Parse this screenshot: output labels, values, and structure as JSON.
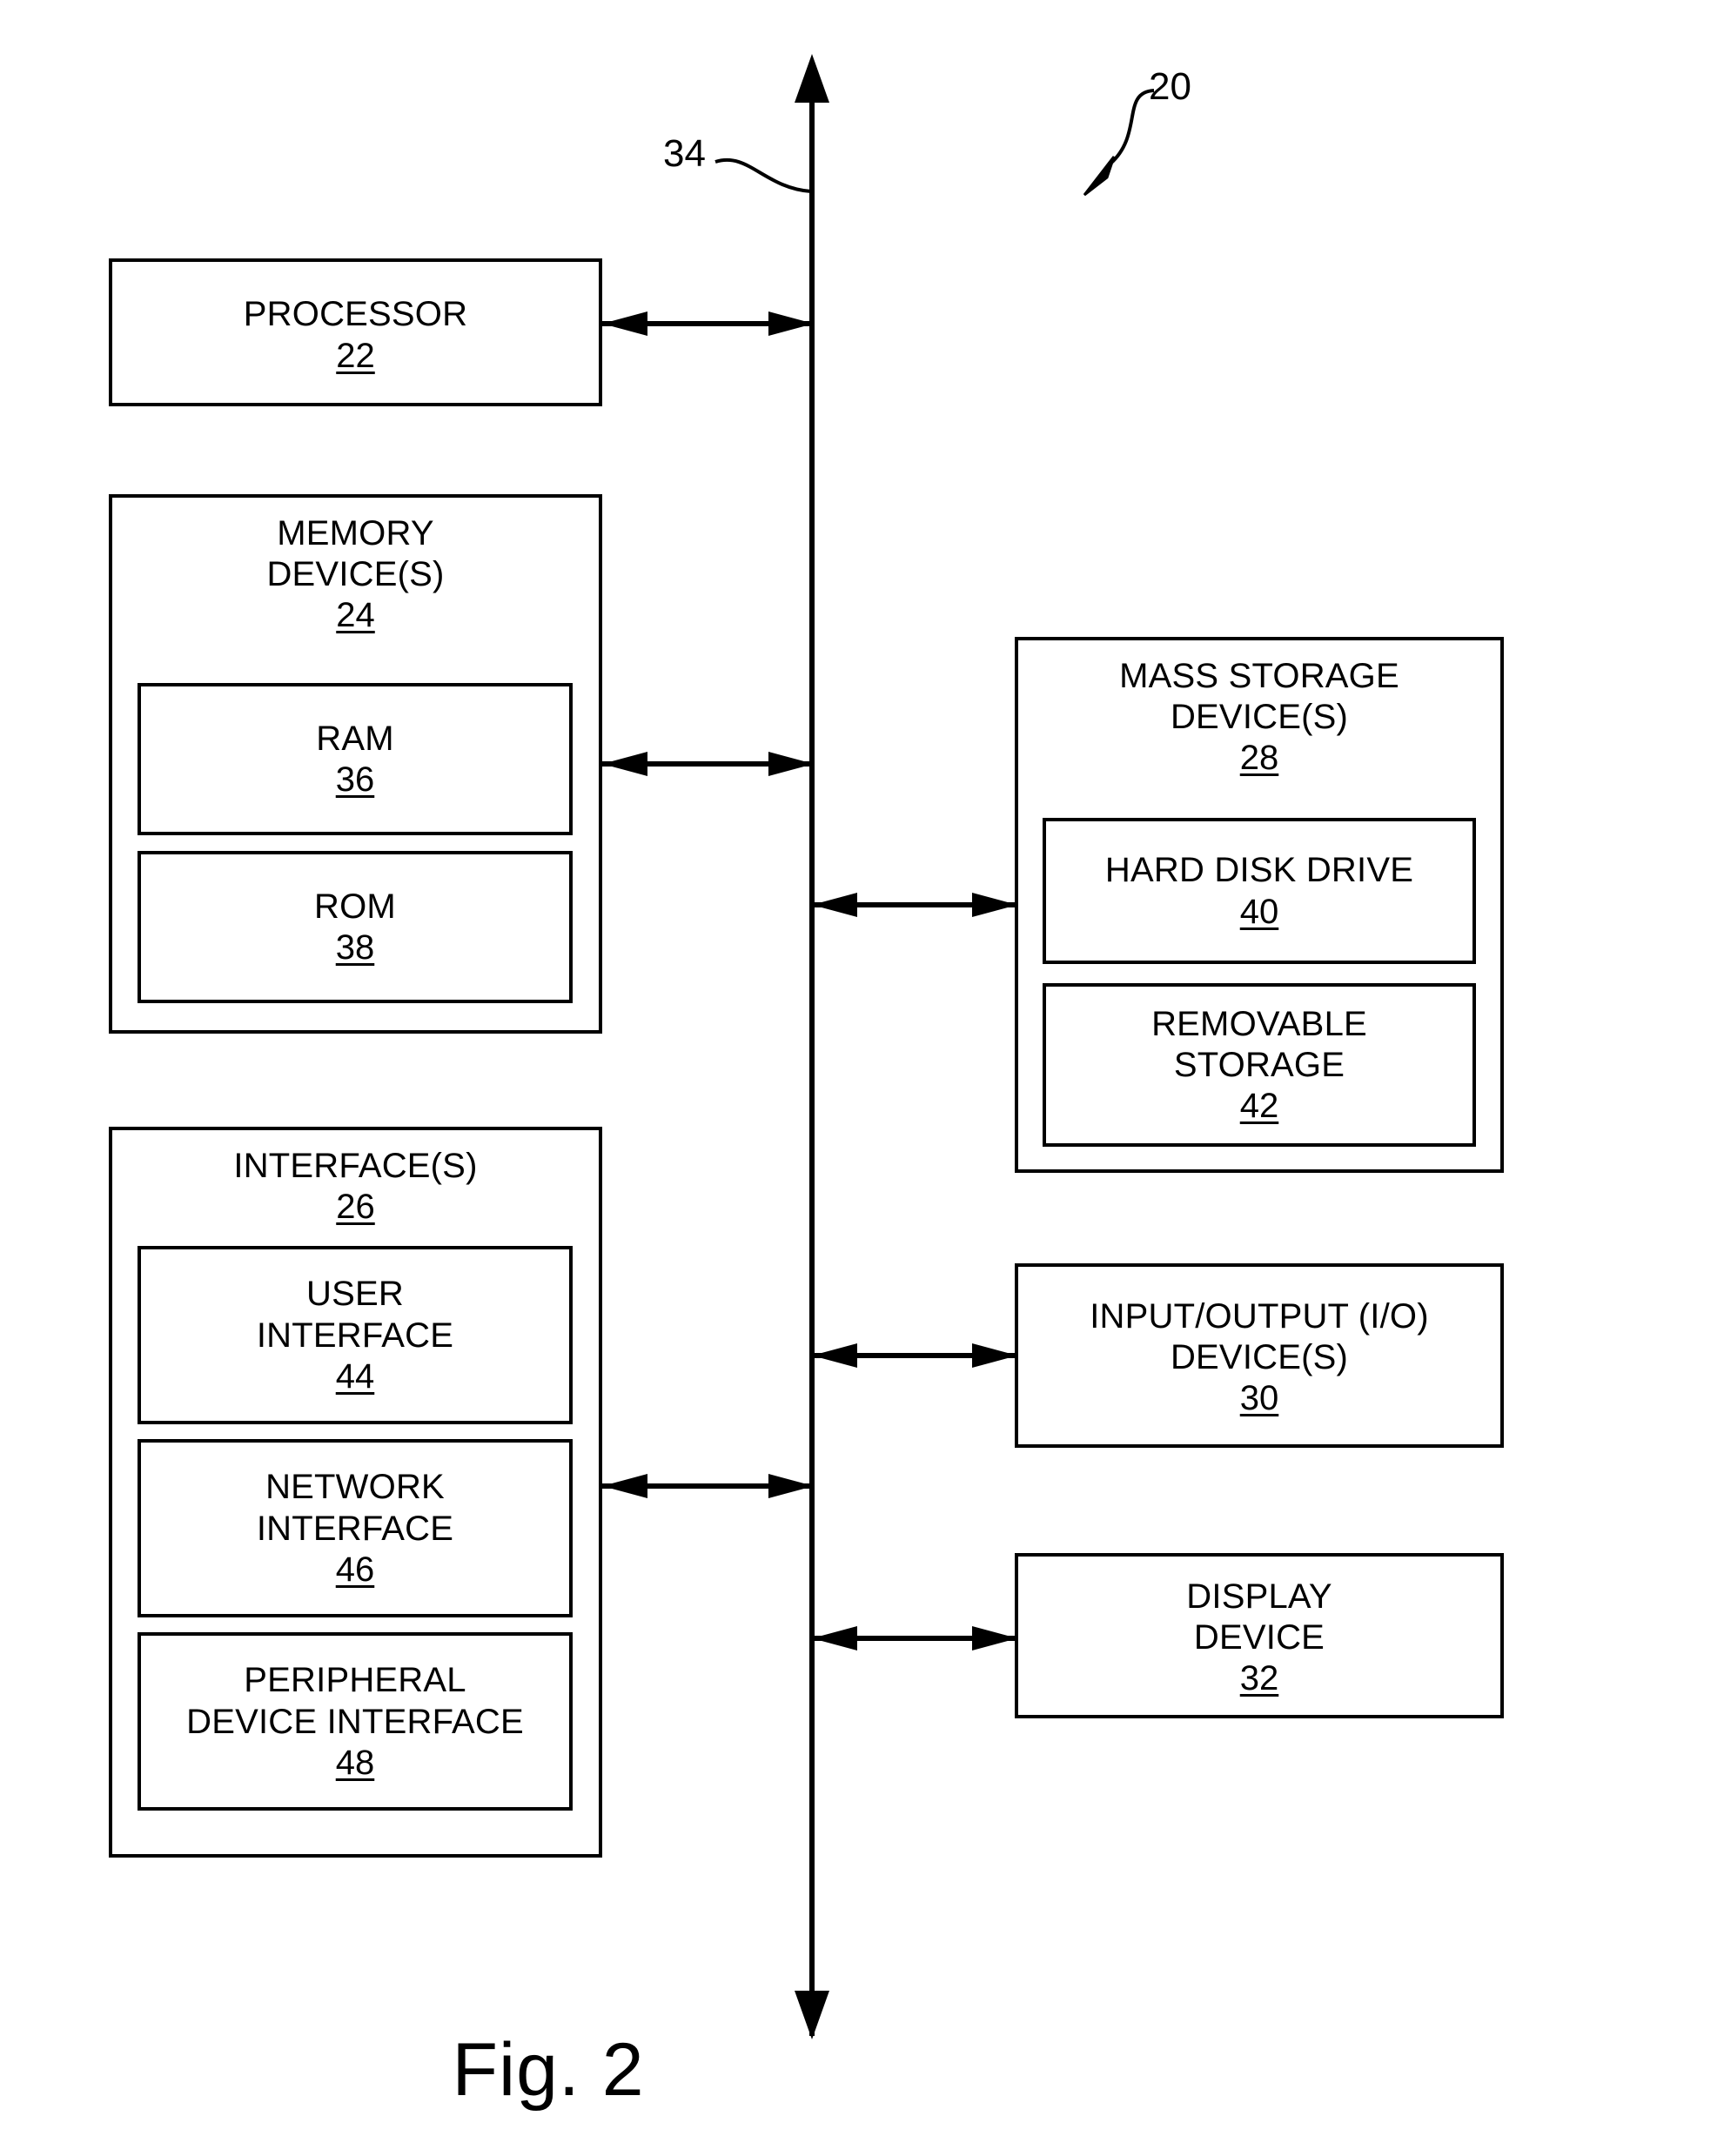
{
  "figure": {
    "caption": "Fig. 2",
    "system_reference": "20",
    "bus_reference": "34"
  },
  "blocks": {
    "processor": {
      "title": "PROCESSOR",
      "ref": "22"
    },
    "memory_devices": {
      "title": "MEMORY\nDEVICE(S)",
      "ref": "24",
      "children": [
        {
          "title": "RAM",
          "ref": "36"
        },
        {
          "title": "ROM",
          "ref": "38"
        }
      ]
    },
    "interfaces": {
      "title": "INTERFACE(S)",
      "ref": "26",
      "children": [
        {
          "title": "USER\nINTERFACE",
          "ref": "44"
        },
        {
          "title": "NETWORK\nINTERFACE",
          "ref": "46"
        },
        {
          "title": "PERIPHERAL\nDEVICE INTERFACE",
          "ref": "48"
        }
      ]
    },
    "mass_storage": {
      "title": "MASS STORAGE\nDEVICE(S)",
      "ref": "28",
      "children": [
        {
          "title": "HARD DISK DRIVE",
          "ref": "40"
        },
        {
          "title": "REMOVABLE\nSTORAGE",
          "ref": "42"
        }
      ]
    },
    "io_devices": {
      "title": "INPUT/OUTPUT (I/O)\nDEVICE(S)",
      "ref": "30"
    },
    "display_device": {
      "title": "DISPLAY\nDEVICE",
      "ref": "32"
    }
  },
  "colors": {
    "ink": "#000000",
    "paper": "#ffffff"
  }
}
